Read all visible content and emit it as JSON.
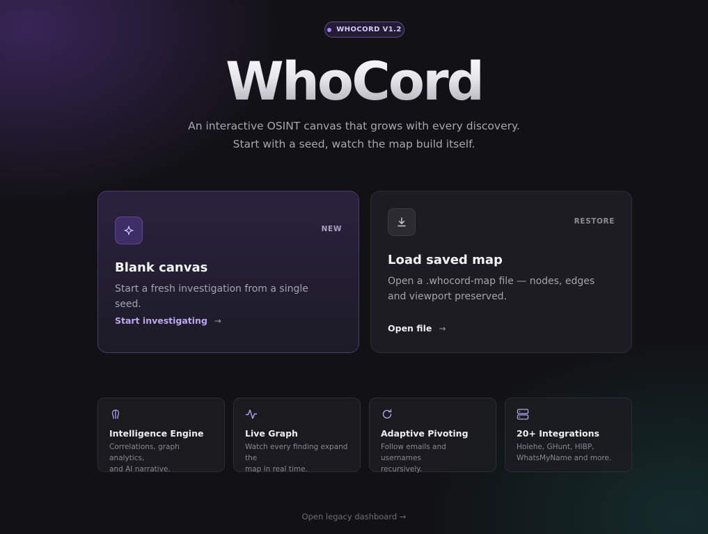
{
  "badge": {
    "label": "WHOCORD V1.2"
  },
  "hero": {
    "title": "WhoCord",
    "subtitle_line1": "An interactive OSINT canvas that grows with every discovery.",
    "subtitle_line2": "Start with a seed, watch the map build itself."
  },
  "cards": [
    {
      "icon": "sparkle-icon",
      "tag": "NEW",
      "title": "Blank canvas",
      "description": "Start a fresh investigation from a single seed.",
      "link": "Start investigating",
      "arrow": "→",
      "accent": "#bba8f0"
    },
    {
      "icon": "download-icon",
      "tag": "RESTORE",
      "title": "Load saved map",
      "description": "Open a .whocord-map file — nodes, edges and viewport preserved.",
      "link": "Open file",
      "arrow": "→"
    }
  ],
  "features": [
    {
      "icon": "brain-icon",
      "title": "Intelligence Engine",
      "line1": "Correlations, graph analytics,",
      "line2": "and AI narrative."
    },
    {
      "icon": "activity-icon",
      "title": "Live Graph",
      "line1": "Watch every finding expand the",
      "line2": "map in real time."
    },
    {
      "icon": "refresh-icon",
      "title": "Adaptive Pivoting",
      "line1": "Follow emails and usernames",
      "line2": "recursively."
    },
    {
      "icon": "server-icon",
      "title": "20+ Integrations",
      "line1": "Holehe, GHunt, HIBP,",
      "line2": "WhatsMyName and more."
    }
  ],
  "footer": {
    "legacy_link": "Open legacy dashboard →"
  },
  "colors": {
    "accent": "#a98cf5",
    "background": "#121215"
  }
}
